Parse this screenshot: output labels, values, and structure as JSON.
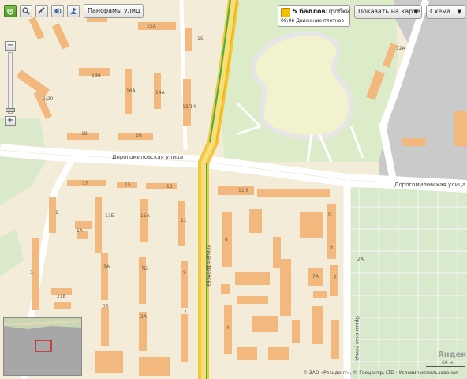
{
  "toolbar": {
    "panoramas_label": "Панорамы улиц",
    "traffic_score": "5 баллов",
    "traffic_label": "Пробки",
    "traffic_time": "08:06 Движение плотное",
    "show_on_map_label": "Показать на карте",
    "scheme_label": "Схема"
  },
  "streets": {
    "dorogomilovskaya_left": "Дорогомиловская улица",
    "dorogomilovskaya_right": "Дорогомиловская улица",
    "vertical_street": "улица Ефремова",
    "vertical_street_2": "Оршанская улица"
  },
  "house_numbers": {
    "h15a": "15А",
    "h15": "15",
    "h18a": "18А",
    "h16a": "16А",
    "h14a": "14А",
    "h2_20": "2/20",
    "h13_14": "13/14",
    "h18": "18",
    "h16": "16",
    "h12a": "12А",
    "h17": "17",
    "h15b": "15",
    "h13": "13",
    "h11_8": "11/8",
    "h1": "1",
    "h13b": "13Б",
    "h15a2": "15А",
    "h11": "11",
    "h1a": "1А",
    "h3": "3",
    "h3a": "3А",
    "h7b": "7Б",
    "h9": "9",
    "h8": "8",
    "h21b": "21Б",
    "h3b": "3б",
    "h2a": "2А",
    "h7": "7",
    "h7a": "7А",
    "h4": "4",
    "h5": "5",
    "h2a_right": "2А",
    "h0": "0"
  },
  "footer": {
    "copyright": "© ЗАО «Резидент», © Геоцентр, LTD · Условия использования",
    "logo": "Яндекс",
    "scale": "60 м"
  },
  "colors": {
    "map_bg": "#f3ecd8",
    "building": "#f2b87d",
    "road": "#ffffff",
    "highway": "#f5cc3c",
    "park": "#dfecc9",
    "industrial": "#c9c9c9",
    "grid_green": "#cfe3c0",
    "traffic_green": "#3fb23f"
  },
  "icons": {
    "hand": "hand-icon",
    "zoom_area": "magnifier-icon",
    "ruler": "ruler-icon",
    "layers": "layers-icon",
    "panorama": "panorama-icon"
  }
}
